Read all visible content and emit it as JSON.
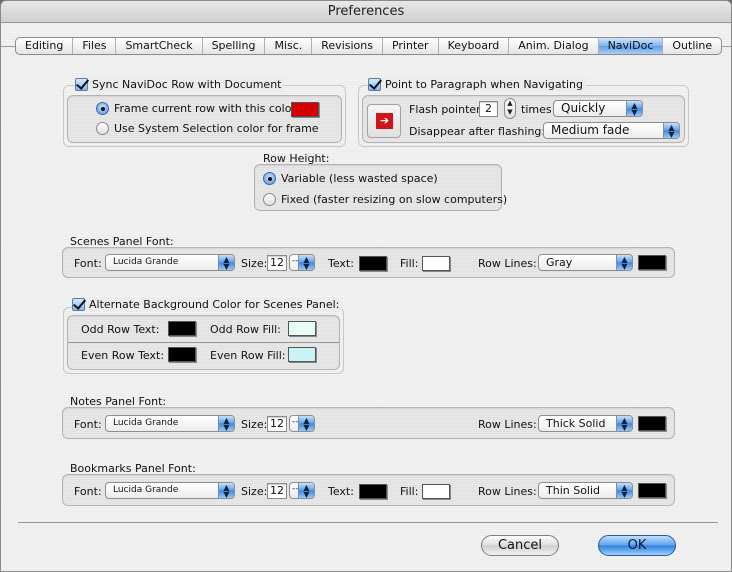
{
  "window": {
    "title": "Preferences"
  },
  "tabs": [
    {
      "label": "Editing",
      "active": false
    },
    {
      "label": "Files",
      "active": false
    },
    {
      "label": "SmartCheck",
      "active": false
    },
    {
      "label": "Spelling",
      "active": false
    },
    {
      "label": "Misc.",
      "active": false
    },
    {
      "label": "Revisions",
      "active": false
    },
    {
      "label": "Printer",
      "active": false
    },
    {
      "label": "Keyboard",
      "active": false
    },
    {
      "label": "Anim. Dialog",
      "active": false
    },
    {
      "label": "NaviDoc",
      "active": true
    },
    {
      "label": "Outline",
      "active": false
    }
  ],
  "sync": {
    "checkbox_label": "Sync NaviDoc Row with Document",
    "checked": true,
    "radio_frame_color": "Frame current row with this color:",
    "radio_system_color": "Use System Selection color for frame",
    "selected": "frame_color",
    "frame_color": "#d40000"
  },
  "point": {
    "checkbox_label": "Point to Paragraph when Navigating",
    "checked": true,
    "pointer_icon": "arrow-right-icon",
    "flash_label": "Flash pointer",
    "flash_count": "2",
    "times_label": "times",
    "speed": "Quickly",
    "disappear_label": "Disappear after flashing:",
    "disappear_value": "Medium fade"
  },
  "row_height": {
    "label": "Row Height:",
    "variable": "Variable (less wasted space)",
    "fixed": "Fixed (faster resizing on slow computers)",
    "selected": "variable"
  },
  "scenes_font": {
    "title": "Scenes Panel Font:",
    "font_label": "Font:",
    "font": "Lucida Grande",
    "size_label": "Size:",
    "size": "12",
    "text_label": "Text:",
    "text_color": "#000000",
    "fill_label": "Fill:",
    "fill_color": "#ffffff",
    "row_lines_label": "Row Lines:",
    "row_lines": "Gray",
    "row_lines_color": "#000000"
  },
  "alt_bg": {
    "checkbox_label": "Alternate Background Color for Scenes Panel:",
    "checked": true,
    "odd_text_label": "Odd Row Text:",
    "odd_text_color": "#000000",
    "odd_fill_label": "Odd Row Fill:",
    "odd_fill_color": "#e8fbf4",
    "even_text_label": "Even Row Text:",
    "even_text_color": "#000000",
    "even_fill_label": "Even Row Fill:",
    "even_fill_color": "#c8f4f6"
  },
  "notes_font": {
    "title": "Notes Panel Font:",
    "font_label": "Font:",
    "font": "Lucida Grande",
    "size_label": "Size:",
    "size": "12",
    "row_lines_label": "Row Lines:",
    "row_lines": "Thick Solid",
    "row_lines_color": "#000000"
  },
  "bookmarks_font": {
    "title": "Bookmarks Panel Font:",
    "font_label": "Font:",
    "font": "Lucida Grande",
    "size_label": "Size:",
    "size": "12",
    "text_label": "Text:",
    "text_color": "#000000",
    "fill_label": "Fill:",
    "fill_color": "#ffffff",
    "row_lines_label": "Row Lines:",
    "row_lines": "Thin Solid",
    "row_lines_color": "#000000"
  },
  "buttons": {
    "cancel": "Cancel",
    "ok": "OK"
  }
}
